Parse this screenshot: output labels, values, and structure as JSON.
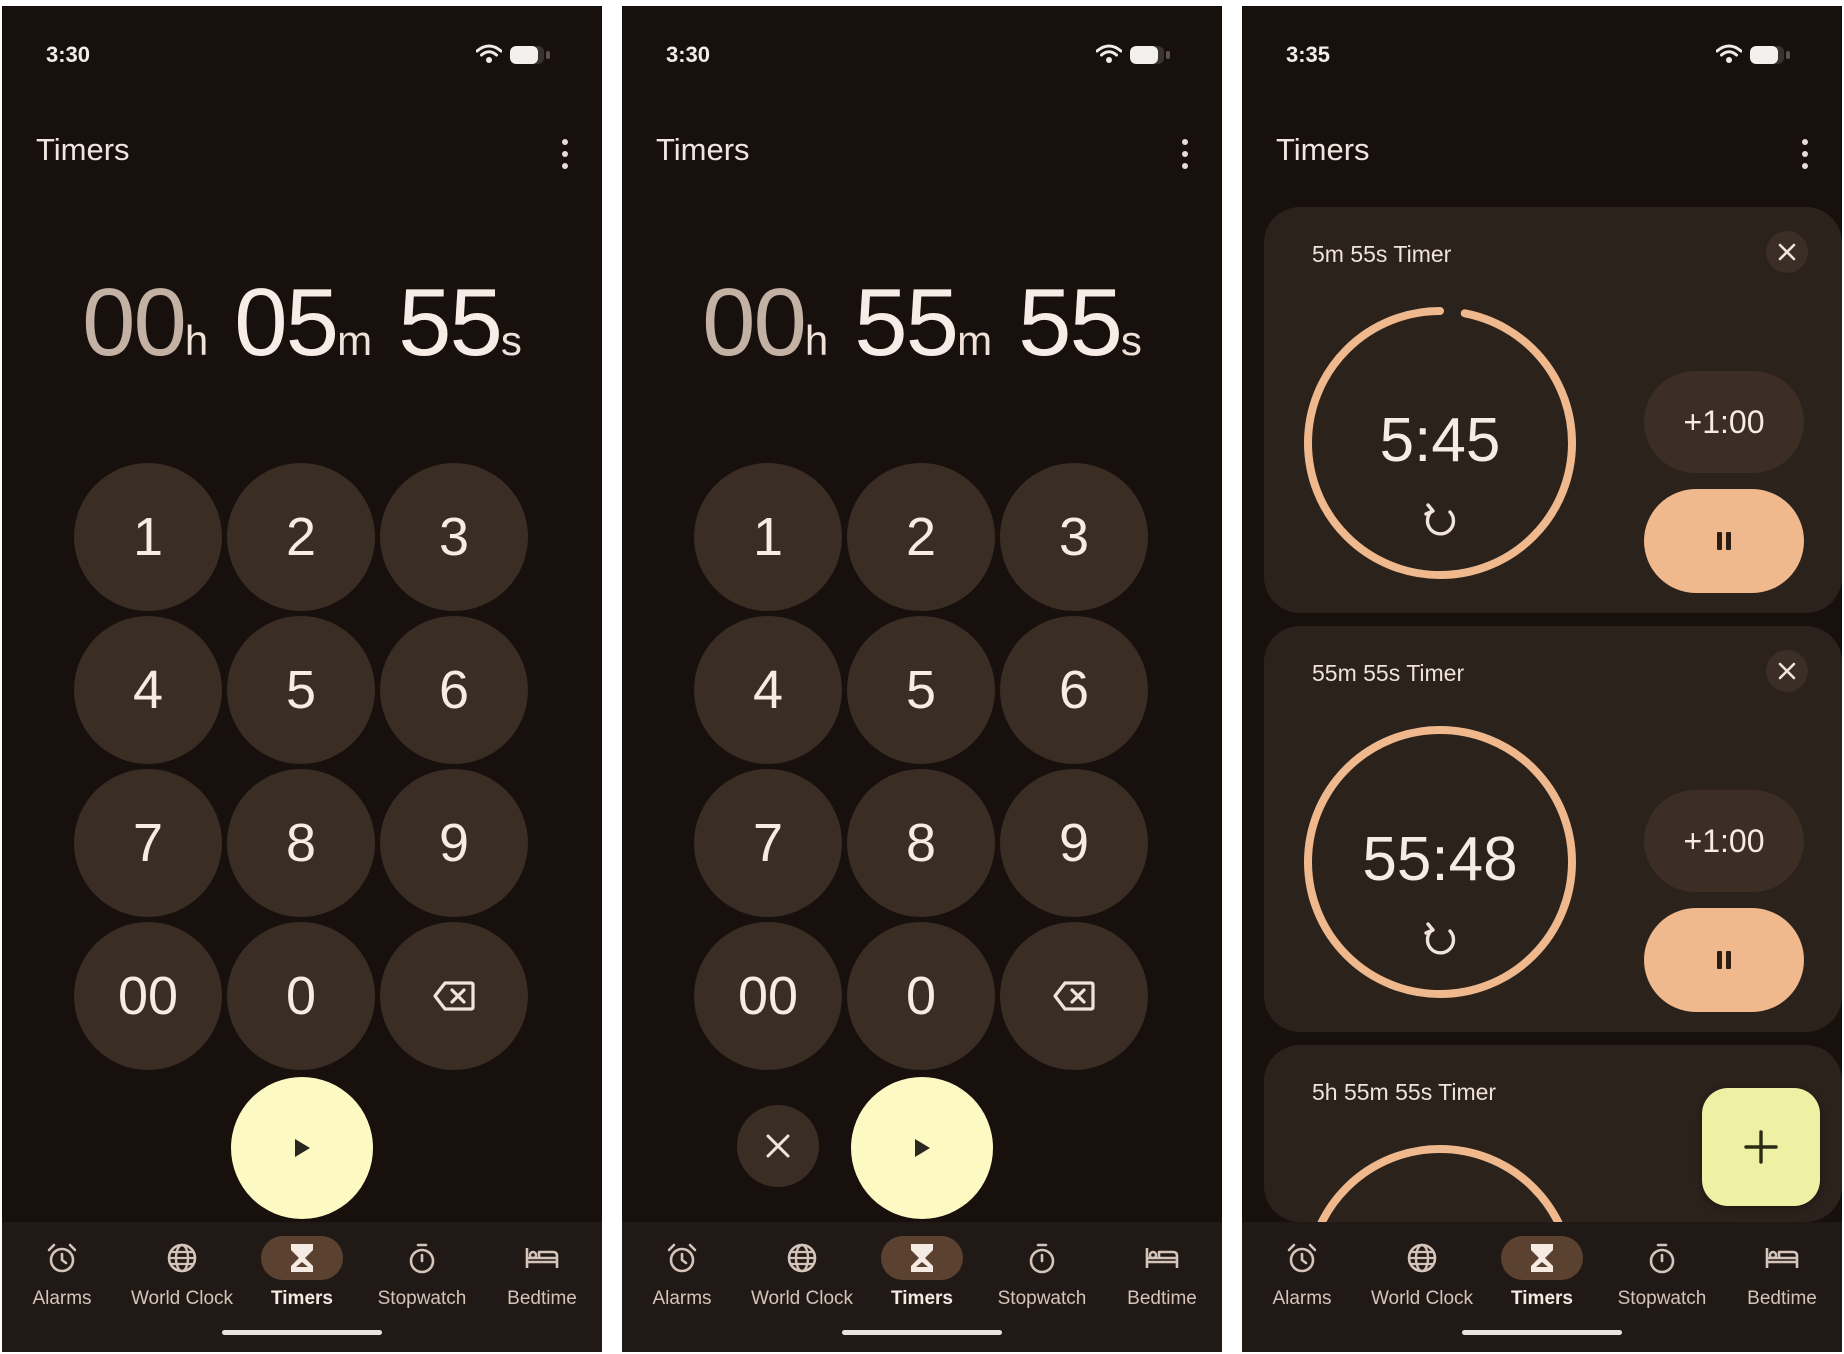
{
  "colors": {
    "background": "#17100d",
    "key_fill": "#3a2d24",
    "start_fab": "#fcf9c2",
    "ring": "#f0b98d",
    "pause_fill": "#f0b98d",
    "add_fab": "#eef1a3",
    "nav_active": "#5b4230"
  },
  "nav": [
    {
      "label": "Alarms",
      "icon": "alarm-icon"
    },
    {
      "label": "World Clock",
      "icon": "globe-icon"
    },
    {
      "label": "Timers",
      "icon": "hourglass-icon"
    },
    {
      "label": "Stopwatch",
      "icon": "stopwatch-icon"
    },
    {
      "label": "Bedtime",
      "icon": "bed-icon"
    }
  ],
  "nav_active": "Timers",
  "keypad": {
    "keys": [
      "1",
      "2",
      "3",
      "4",
      "5",
      "6",
      "7",
      "8",
      "9",
      "00",
      "0"
    ],
    "backspace_icon": "backspace-icon",
    "start_icon": "play-icon",
    "clear_icon": "close-icon"
  },
  "screens": [
    {
      "status_time": "3:30",
      "title": "Timers",
      "duration": {
        "hours": "00",
        "hours_unit": "h",
        "minutes": "05",
        "minutes_unit": "m",
        "seconds": "55",
        "seconds_unit": "s"
      }
    },
    {
      "status_time": "3:30",
      "title": "Timers",
      "duration": {
        "hours": "00",
        "hours_unit": "h",
        "minutes": "55",
        "minutes_unit": "m",
        "seconds": "55",
        "seconds_unit": "s"
      }
    },
    {
      "status_time": "3:35",
      "title": "Timers",
      "timers": [
        {
          "name": "5m 55s Timer",
          "remaining": "5:45",
          "add_label": "+1:00",
          "progress": 0.97
        },
        {
          "name": "55m 55s Timer",
          "remaining": "55:48",
          "add_label": "+1:00",
          "progress": 1.0
        },
        {
          "name": "5h 55m 55s Timer",
          "progress": 1.0
        }
      ],
      "add_fab_icon": "plus-icon"
    }
  ]
}
